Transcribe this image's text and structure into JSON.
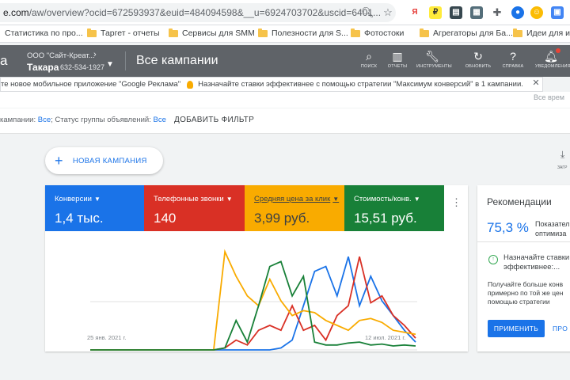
{
  "browser": {
    "url_host": "e.com",
    "url_rest": "/aw/overview?ocid=672593937&euid=484094598&__u=6924703702&uscid=6401..."
  },
  "bookmarks": [
    {
      "label": "Статистика по про..."
    },
    {
      "label": "Таргет - отчеты"
    },
    {
      "label": "Сервисы для SMM"
    },
    {
      "label": "Полезности для S..."
    },
    {
      "label": "Фотостоки"
    },
    {
      "label": "Агрегаторы для Ба..."
    },
    {
      "label": "Идеи для игр"
    }
  ],
  "header": {
    "brand": "а",
    "account_name": "ООО \"Сайт-Креат...",
    "account_user": "Такара",
    "account_id": "632-534-1927",
    "page_title": "Все кампании",
    "tools": [
      {
        "label": "ПОИСК",
        "icon": "search-icon"
      },
      {
        "label": "ОТЧЕТЫ",
        "icon": "reports-icon"
      },
      {
        "label": "ИНСТРУМЕНТЫ",
        "icon": "tools-icon"
      },
      {
        "label": "ОБНОВИТЬ",
        "icon": "refresh-icon"
      },
      {
        "label": "СПРАВКА",
        "icon": "help-icon"
      },
      {
        "label": "УВЕДОМЛЕНИЯ",
        "icon": "notifications-icon"
      }
    ]
  },
  "notification": {
    "text1": "те новое мобильное приложение \"Google Реклама\"",
    "text2": "Назначайте ставки эффективнее с помощью стратегии \"Максимум конверсий\" в 1 кампании.",
    "faded": "Все врем"
  },
  "filter": {
    "prefix": "кампании: ",
    "v1": "Все",
    "middle": "; Статус группы объявлений: ",
    "v2": "Все",
    "add_filter": "ДОБАВИТЬ ФИЛЬТР"
  },
  "new_campaign": {
    "label": "НОВАЯ КАМПАНИЯ"
  },
  "download": {
    "label": "ЗАГР"
  },
  "metrics": [
    {
      "label": "Конверсии",
      "value": "1,4 тыс.",
      "color": "#1a73e8"
    },
    {
      "label": "Телефонные звонки",
      "value": "140",
      "color": "#d93025"
    },
    {
      "label": "Средняя цена за клик",
      "value": "3,99 руб.",
      "color": "#f9ab00"
    },
    {
      "label": "Стоимость/конв.",
      "value": "15,51 руб.",
      "color": "#188038"
    }
  ],
  "chart_data": {
    "type": "line",
    "x_start_label": "25 янв. 2021 г.",
    "x_end_label": "12 июл. 2021 г.",
    "x": [
      0,
      1,
      2,
      3,
      4,
      5,
      6,
      7,
      8,
      9,
      10,
      11,
      12,
      13,
      14,
      15,
      16,
      17,
      18,
      19,
      20,
      21,
      22,
      23,
      24,
      25,
      26,
      27,
      28,
      29
    ],
    "series": [
      {
        "name": "Конверсии",
        "color": "#1a73e8",
        "values": [
          0,
          0,
          0,
          0,
          0,
          0,
          0,
          0,
          0,
          0,
          0,
          0,
          0,
          0,
          0,
          0,
          0,
          0.02,
          0.1,
          0.45,
          0.8,
          0.85,
          0.55,
          0.95,
          0.45,
          0.75,
          0.5,
          0.35,
          0.2,
          0.08
        ]
      },
      {
        "name": "Телефонные звонки",
        "color": "#d93025",
        "values": [
          0,
          0,
          0,
          0,
          0,
          0,
          0,
          0,
          0,
          0,
          0,
          0,
          0.02,
          0.1,
          0.05,
          0.2,
          0.25,
          0.2,
          0.45,
          0.2,
          0.25,
          0.1,
          0.35,
          0.45,
          0.95,
          0.48,
          0.55,
          0.35,
          0.25,
          0.12
        ]
      },
      {
        "name": "Средняя цена за клик",
        "color": "#f9ab00",
        "values": [
          0,
          0,
          0,
          0,
          0,
          0,
          0,
          0,
          0,
          0,
          0,
          0,
          1.0,
          0.75,
          0.55,
          0.45,
          0.72,
          0.5,
          0.35,
          0.4,
          0.38,
          0.3,
          0.25,
          0.2,
          0.3,
          0.32,
          0.28,
          0.2,
          0.18,
          0.16
        ]
      },
      {
        "name": "Стоимость/конв.",
        "color": "#188038",
        "values": [
          0,
          0,
          0,
          0,
          0,
          0,
          0,
          0,
          0,
          0,
          0,
          0,
          0.02,
          0.3,
          0.08,
          0.45,
          0.85,
          0.9,
          0.55,
          0.75,
          0.08,
          0.05,
          0.05,
          0.07,
          0.08,
          0.05,
          0.06,
          0.04,
          0.05,
          0.04
        ]
      }
    ]
  },
  "recommendations": {
    "title": "Рекомендации",
    "score": "75,3 %",
    "score_label_1": "Показател",
    "score_label_2": "оптимиза",
    "item_title_1": "Назначайте ставки",
    "item_title_2": "эффективнее:...",
    "body_1": "Получайте больше конв",
    "body_2": "примерно по той же цен",
    "body_3": "помощью стратегии",
    "apply": "ПРИМЕНИТЬ",
    "view": "ПРО"
  }
}
